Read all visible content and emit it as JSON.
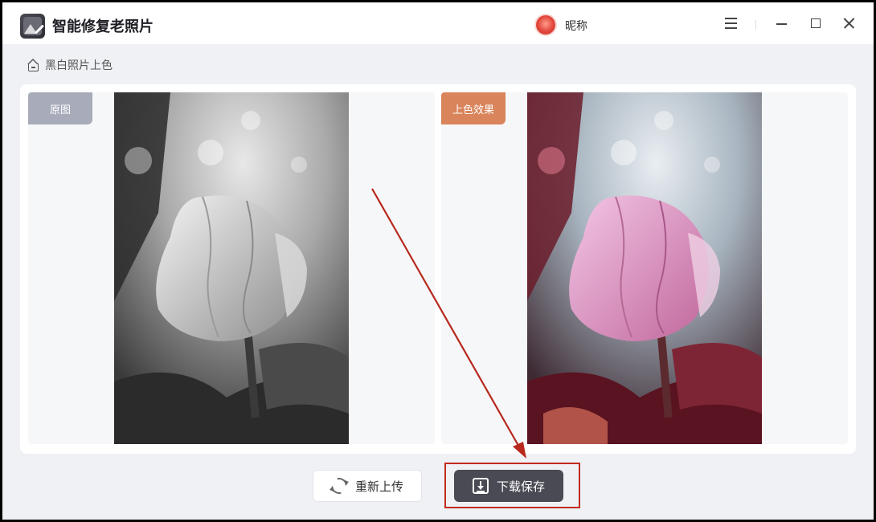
{
  "titlebar": {
    "app_title": "智能修复老照片",
    "nickname": "昵称"
  },
  "breadcrumb": {
    "label": "黑白照片上色"
  },
  "panels": {
    "original_tag": "原图",
    "colorized_tag": "上色效果"
  },
  "buttons": {
    "reupload": "重新上传",
    "download": "下载保存"
  },
  "colors": {
    "accent_dark": "#4a4a55",
    "tag_gray": "#a8abba",
    "tag_orange": "#d9845a",
    "annotation_red": "#c02a1f"
  },
  "icons": [
    "app-logo-icon",
    "avatar-icon",
    "menu-icon",
    "minimize-icon",
    "maximize-icon",
    "close-icon",
    "home-icon",
    "refresh-icon",
    "download-icon"
  ]
}
